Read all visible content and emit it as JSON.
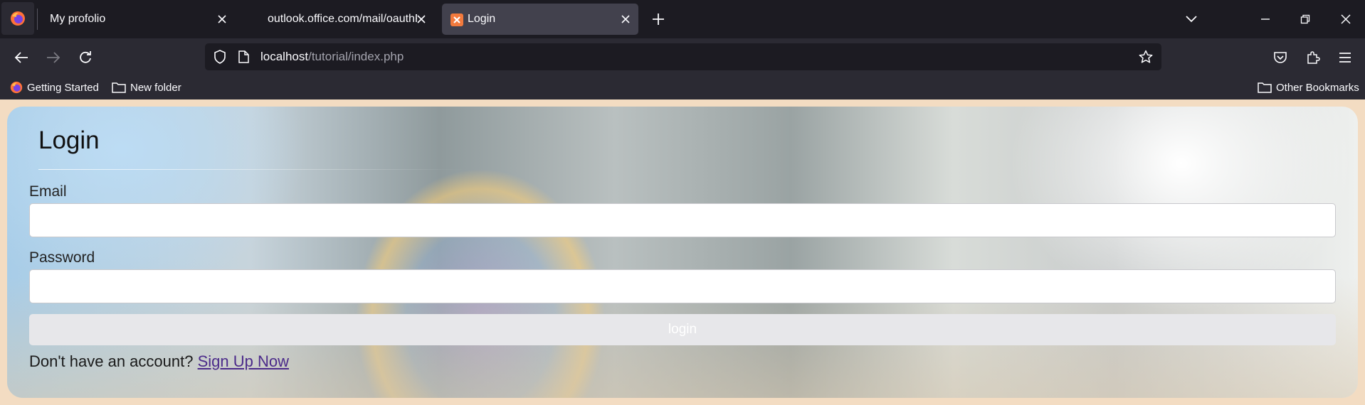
{
  "browser": {
    "tabs": [
      {
        "label": "My profolio",
        "active": false
      },
      {
        "label": "outlook.office.com/mail/oauthRedirect",
        "active": false
      },
      {
        "label": "Login",
        "active": true
      }
    ],
    "url": {
      "host": "localhost",
      "path": "/tutorial/index.php"
    },
    "bookmarks": [
      {
        "label": "Getting Started",
        "icon": "firefox-icon"
      },
      {
        "label": "New folder",
        "icon": "folder-icon"
      }
    ],
    "other_bookmarks": "Other Bookmarks"
  },
  "form": {
    "title": "Login",
    "email_label": "Email",
    "email_value": "",
    "password_label": "Password",
    "password_value": "",
    "submit_label": "login",
    "signup_prompt": "Don't have an account?",
    "signup_link": "Sign Up Now"
  },
  "colors": {
    "chrome_dark": "#1c1b22",
    "chrome": "#2b2a33",
    "active_tab": "#42414d",
    "page_bg": "#f3dcc2",
    "link": "#4b2a8a"
  }
}
